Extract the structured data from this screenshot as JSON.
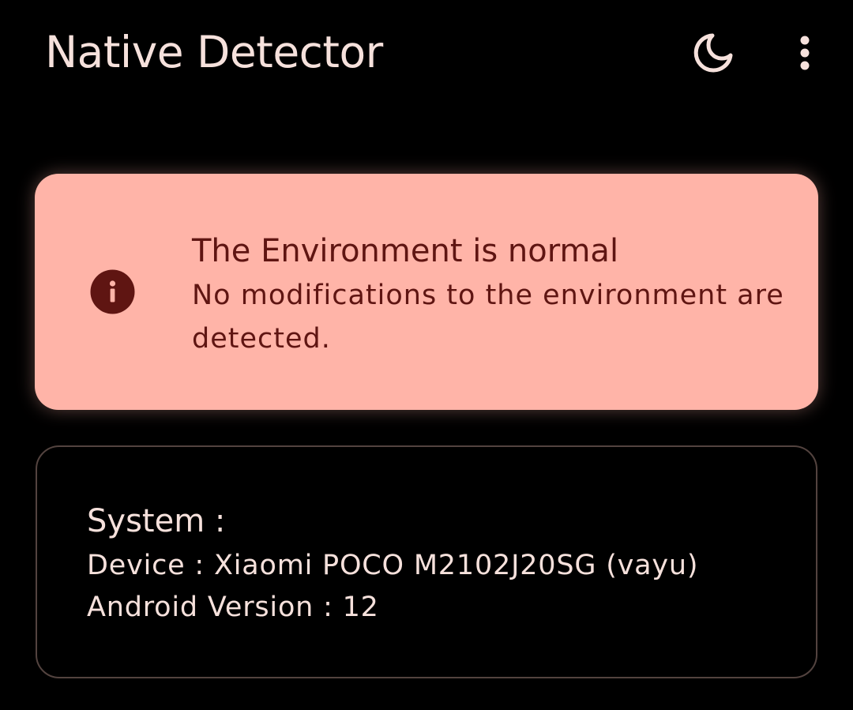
{
  "app_bar": {
    "title": "Native Detector",
    "actions": [
      {
        "icon": "moon-icon"
      },
      {
        "icon": "more-vert-icon"
      }
    ]
  },
  "status_card": {
    "icon": "info-icon",
    "title": "The Environment is normal",
    "description": "No modifications to the environment are detected."
  },
  "system_card": {
    "heading": "System :",
    "device": "Device : Xiaomi POCO M2102J20SG  (vayu)",
    "android_version": "Android Version : 12"
  },
  "colors": {
    "background": "#000000",
    "on_surface": "#f6e1dc",
    "status_container": "#ffb4a8",
    "on_status_container": "#5f1512",
    "outline": "#53433f"
  }
}
